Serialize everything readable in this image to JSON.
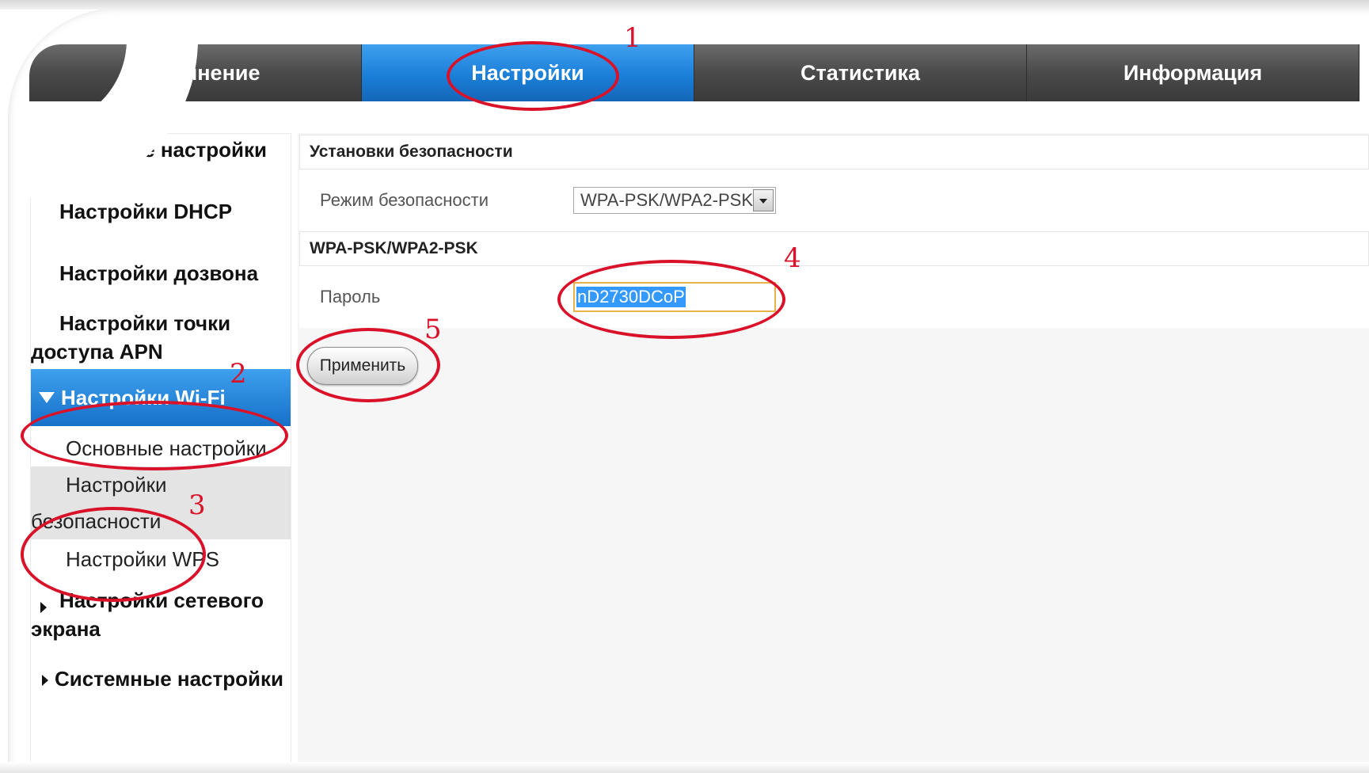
{
  "topnav": {
    "tabs": [
      {
        "label": "Соединение"
      },
      {
        "label": "Настройки"
      },
      {
        "label": "Статистика"
      },
      {
        "label": "Информация"
      }
    ],
    "active_index": 1
  },
  "sidebar": {
    "quick": "Быстрые настройки",
    "dhcp": "Настройки DHCP",
    "dial": "Настройки дозвона",
    "apn_line1": "Настройки точки",
    "apn_line2": "доступа APN",
    "wifi": "Настройки Wi-Fi",
    "wifi_sub": {
      "basic": "Основные настройки",
      "security_line1": "Настройки",
      "security_line2": "безопасности",
      "wps": "Настройки WPS"
    },
    "firewall_line1": "Настройки сетевого",
    "firewall_line2": "экрана",
    "system": "Системные настройки"
  },
  "content": {
    "section_title": "Установки безопасности",
    "mode_label": "Режим безопасности",
    "mode_value": "WPA-PSK/WPA2-PSK",
    "subsection_title": "WPA-PSK/WPA2-PSK",
    "password_label": "Пароль",
    "password_value": "nD2730DCoP",
    "apply_label": "Применить"
  },
  "annotations": {
    "n1": "1",
    "n2": "2",
    "n3": "3",
    "n4": "4",
    "n5": "5",
    "color": "#d9122a"
  },
  "colors": {
    "accent_blue": "#1b7fd8",
    "nav_dark": "#4a4a4a",
    "input_border": "#e8b24a"
  }
}
